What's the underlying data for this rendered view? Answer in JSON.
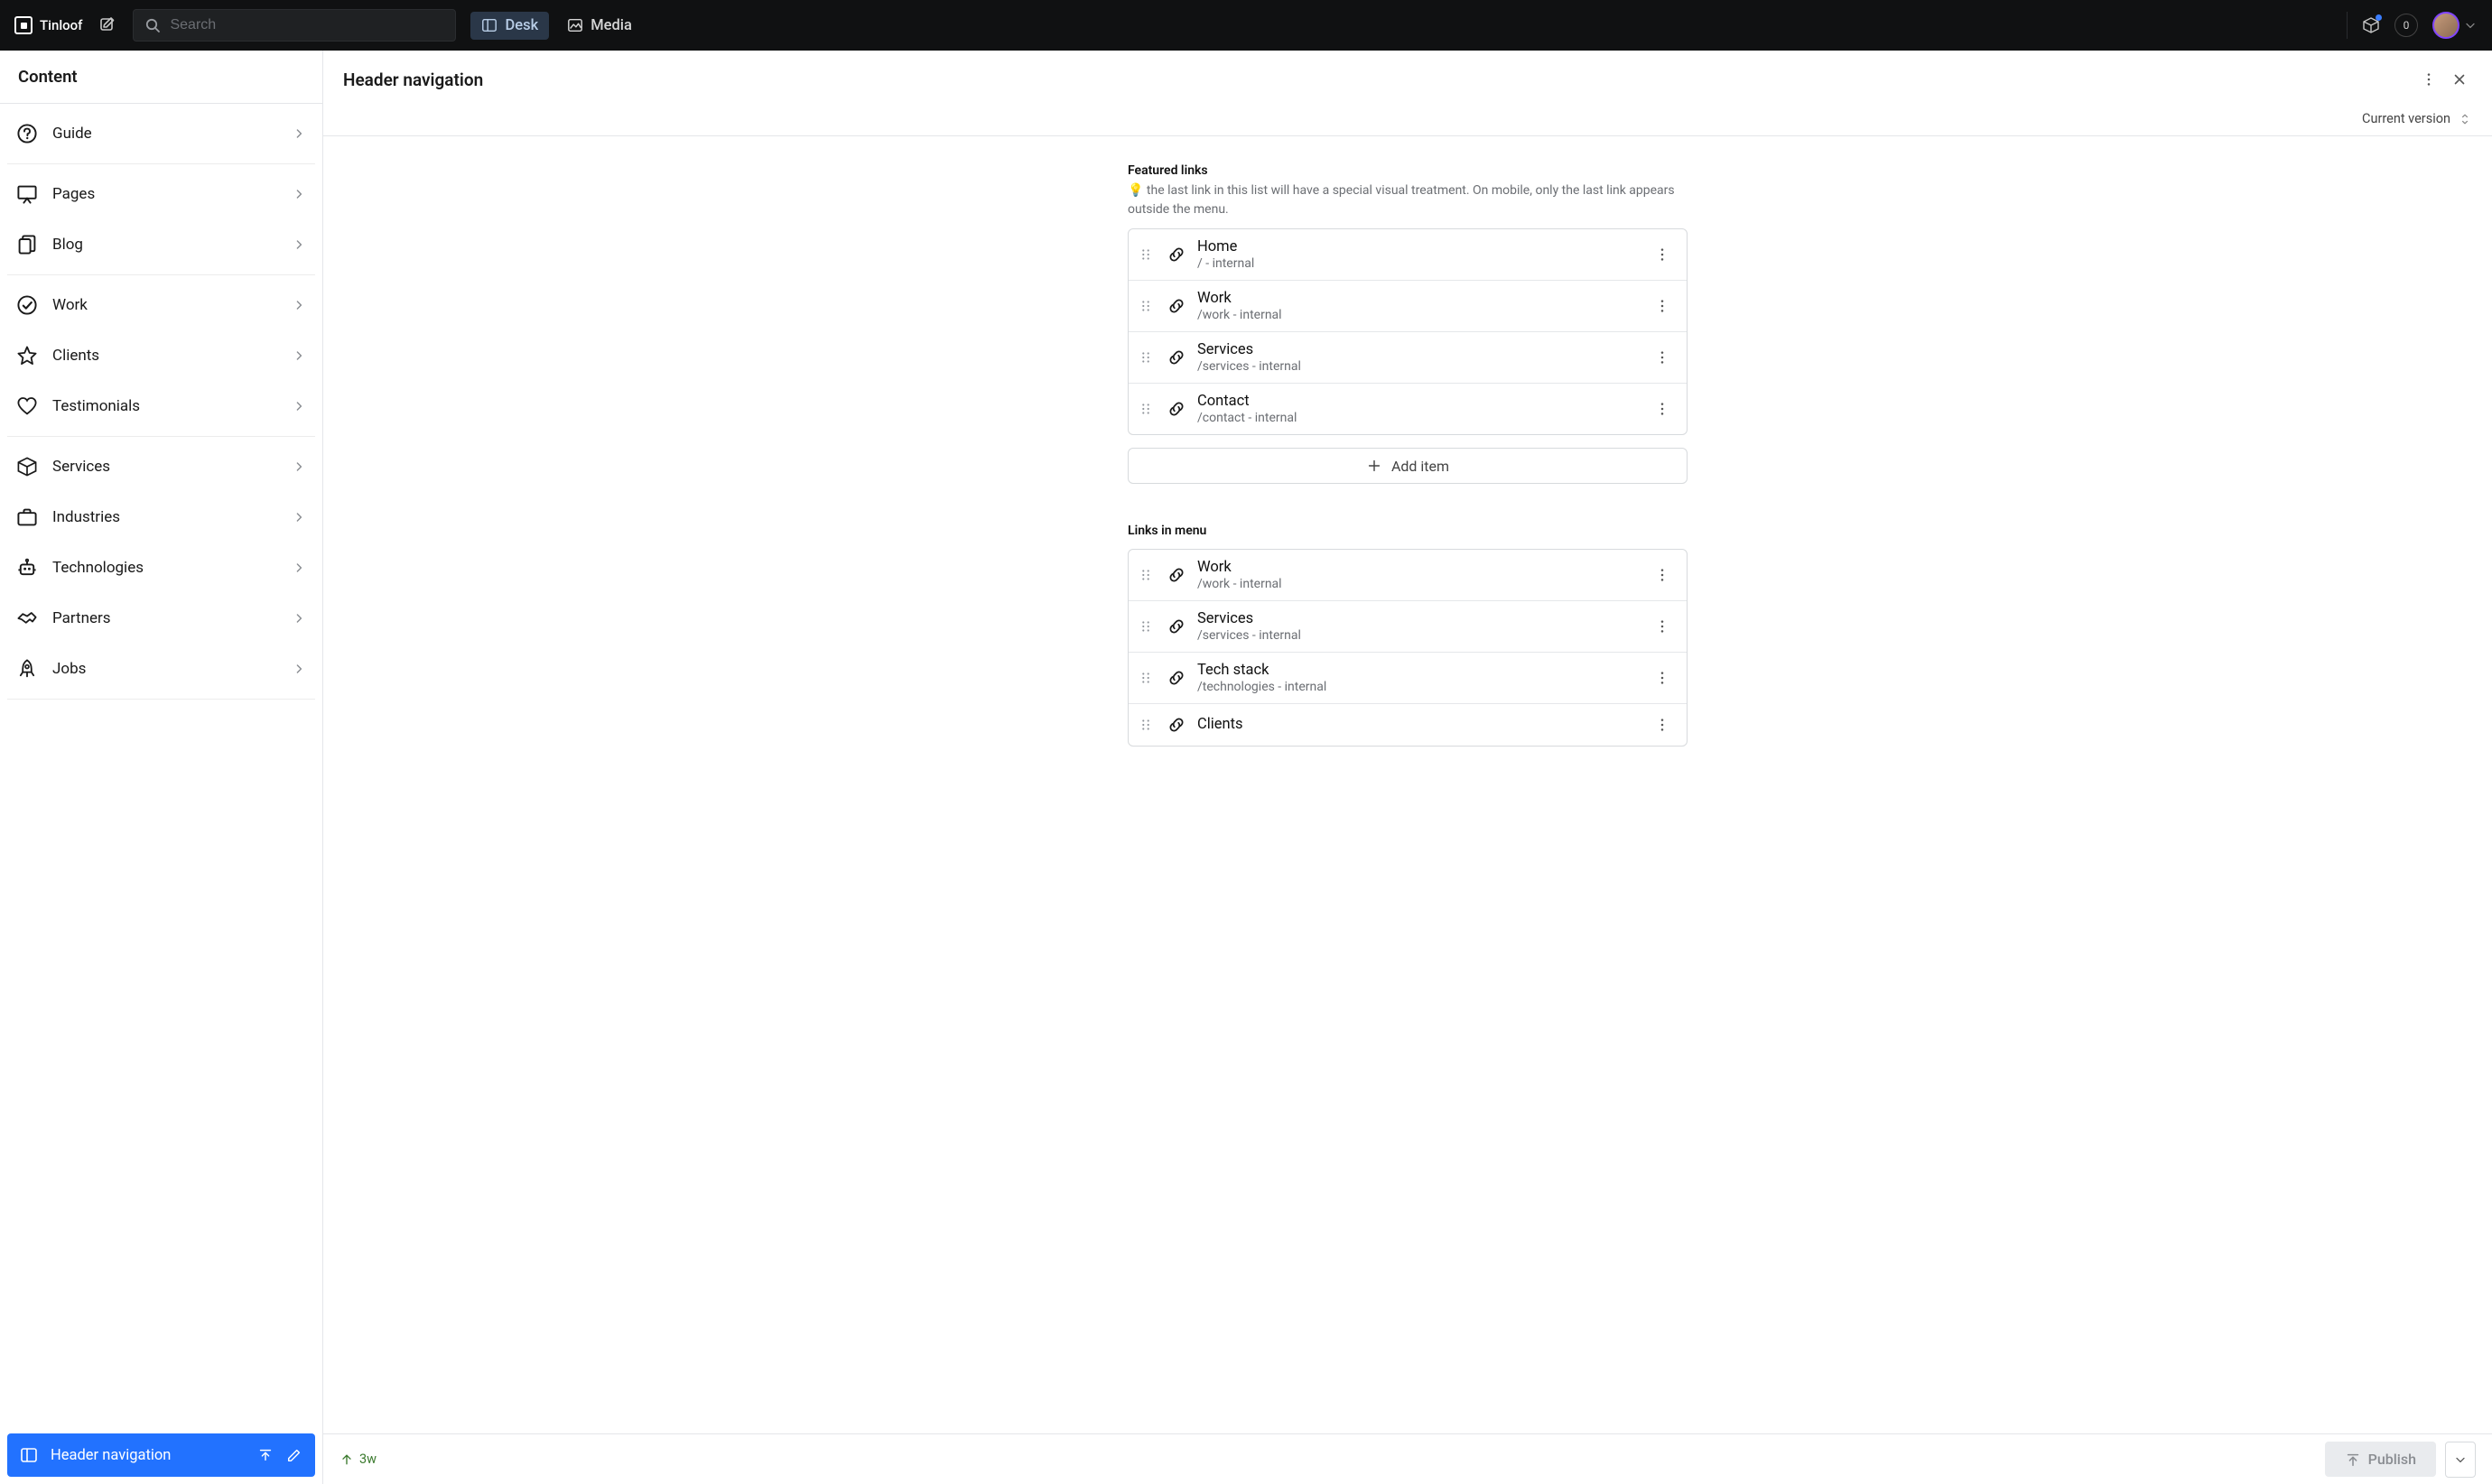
{
  "nav": {
    "brand": "Tinloof",
    "search_placeholder": "Search",
    "tabs": [
      {
        "label": "Desk",
        "active": true
      },
      {
        "label": "Media",
        "active": false
      }
    ],
    "notif_count": "0"
  },
  "sidebar": {
    "title": "Content",
    "groups": [
      [
        {
          "label": "Guide",
          "icon": "question"
        }
      ],
      [
        {
          "label": "Pages",
          "icon": "presentation"
        },
        {
          "label": "Blog",
          "icon": "documents"
        }
      ],
      [
        {
          "label": "Work",
          "icon": "check-circle"
        },
        {
          "label": "Clients",
          "icon": "star"
        },
        {
          "label": "Testimonials",
          "icon": "heart"
        }
      ],
      [
        {
          "label": "Services",
          "icon": "cube"
        },
        {
          "label": "Industries",
          "icon": "briefcase"
        },
        {
          "label": "Technologies",
          "icon": "robot"
        },
        {
          "label": "Partners",
          "icon": "handshake"
        },
        {
          "label": "Jobs",
          "icon": "rocket"
        }
      ]
    ],
    "active": {
      "label": "Header navigation",
      "icon": "panel"
    }
  },
  "document": {
    "title": "Header navigation",
    "version_label": "Current version",
    "sections": [
      {
        "label": "Featured links",
        "desc_emoji": "💡",
        "description": "the last link in this list will have a special visual treatment. On mobile, only the last link appears outside the menu.",
        "items": [
          {
            "title": "Home",
            "sub": "/ - internal"
          },
          {
            "title": "Work",
            "sub": "/work - internal"
          },
          {
            "title": "Services",
            "sub": "/services - internal"
          },
          {
            "title": "Contact",
            "sub": "/contact - internal"
          }
        ],
        "add_label": "Add item"
      },
      {
        "label": "Links in menu",
        "description": "",
        "items": [
          {
            "title": "Work",
            "sub": "/work - internal"
          },
          {
            "title": "Services",
            "sub": "/services - internal"
          },
          {
            "title": "Tech stack",
            "sub": "/technologies - internal"
          },
          {
            "title": "Clients",
            "sub": ""
          }
        ]
      }
    ],
    "updated": "3w",
    "publish_label": "Publish"
  }
}
